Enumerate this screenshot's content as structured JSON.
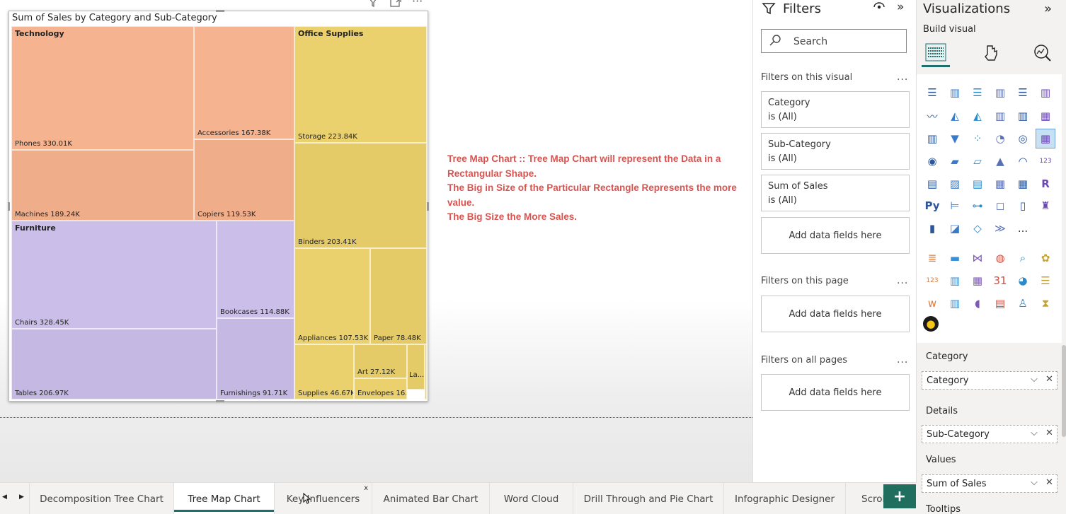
{
  "visual": {
    "title": "Sum of Sales by Category and Sub-Category",
    "header_icons": [
      "filter-icon",
      "focus-mode-icon",
      "more-options-icon"
    ]
  },
  "chart_data": {
    "type": "treemap",
    "title": "Sum of Sales by Category and Sub-Category",
    "groups": [
      {
        "name": "Technology",
        "items": [
          {
            "label": "Phones 330.01K",
            "value": 330.01
          },
          {
            "label": "Machines 189.24K",
            "value": 189.24
          },
          {
            "label": "Accessories 167.38K",
            "value": 167.38
          },
          {
            "label": "Copiers 119.53K",
            "value": 119.53
          }
        ]
      },
      {
        "name": "Furniture",
        "items": [
          {
            "label": "Chairs 328.45K",
            "value": 328.45
          },
          {
            "label": "Tables 206.97K",
            "value": 206.97
          },
          {
            "label": "Bookcases 114.88K",
            "value": 114.88
          },
          {
            "label": "Furnishings 91.71K",
            "value": 91.71
          }
        ]
      },
      {
        "name": "Office Supplies",
        "items": [
          {
            "label": "Storage 223.84K",
            "value": 223.84
          },
          {
            "label": "Binders 203.41K",
            "value": 203.41
          },
          {
            "label": "Appliances 107.53K",
            "value": 107.53
          },
          {
            "label": "Paper 78.48K",
            "value": 78.48
          },
          {
            "label": "Supplies 46.67K",
            "value": 46.67
          },
          {
            "label": "Art 27.12K",
            "value": 27.12
          },
          {
            "label": "Envelopes 16....",
            "value": 16.48
          },
          {
            "label": "La...",
            "value": 12.49
          },
          {
            "label": "",
            "value": 3.0
          }
        ]
      }
    ],
    "colors": {
      "Technology": "#f6b38f",
      "Furniture": "#cbbfe9",
      "Office Supplies": "#ebd16d"
    }
  },
  "note": {
    "lines": [
      "Tree Map Chart :: Tree Map Chart will represent the Data in a Rectangular Shape.",
      "The Big in Size of the Particular Rectangle Represents the more value.",
      "The Big Size the More Sales."
    ],
    "color": "#d9534f"
  },
  "filters": {
    "title": "Filters",
    "search_placeholder": "Search",
    "on_visual_label": "Filters on this visual",
    "cards": [
      {
        "name": "Category",
        "value": "is (All)"
      },
      {
        "name": "Sub-Category",
        "value": "is (All)"
      },
      {
        "name": "Sum of Sales",
        "value": "is (All)"
      }
    ],
    "add_data_label": "Add data fields here",
    "on_page_label": "Filters on this page",
    "on_all_pages_label": "Filters on all pages",
    "more_label": "..."
  },
  "visualizations": {
    "title": "Visualizations",
    "collapse": "»",
    "build_label": "Build visual",
    "wells": [
      {
        "label": "Category",
        "field": "Category"
      },
      {
        "label": "Details",
        "field": "Sub-Category"
      },
      {
        "label": "Values",
        "field": "Sum of Sales"
      }
    ],
    "tooltips_label": "Tooltips",
    "icon_text": {
      "table_123": "123",
      "r_visual": "R",
      "python_visual": "Py",
      "more": "...",
      "calendar_31": "31",
      "card_123": "123",
      "word_w": "w"
    }
  },
  "page_tabs": {
    "tabs": [
      {
        "label": "Decomposition Tree Chart",
        "active": false
      },
      {
        "label": "Tree Map Chart",
        "active": true
      },
      {
        "label": "Key Influencers",
        "active": false,
        "close": "x"
      },
      {
        "label": "Animated Bar Chart",
        "active": false
      },
      {
        "label": "Word Cloud",
        "active": false
      },
      {
        "label": "Drill Through and Pie Chart",
        "active": false
      },
      {
        "label": "Infographic Designer",
        "active": false
      },
      {
        "label": "Scrol",
        "active": false
      }
    ],
    "add_label": "+",
    "prev": "◀",
    "next": "▶"
  }
}
